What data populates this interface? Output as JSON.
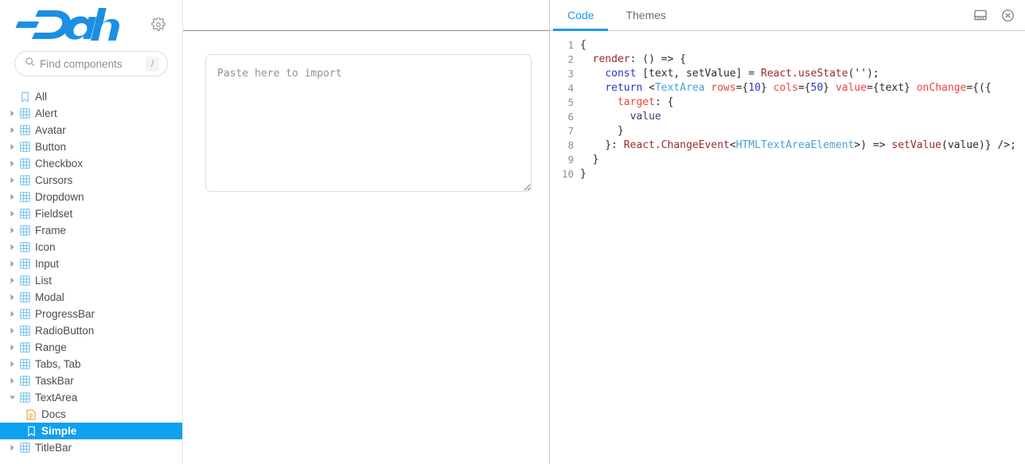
{
  "app": {
    "brand": "Dash",
    "gear_icon": "gear-icon"
  },
  "search": {
    "placeholder": "Find components",
    "value": "",
    "shortcut": "/",
    "icon": "search-icon"
  },
  "sidebar": {
    "items": [
      {
        "label": "All",
        "depth": 0,
        "icon": "bookmark-icon",
        "arrow": "none",
        "selected": false
      },
      {
        "label": "Alert",
        "depth": 0,
        "icon": "grid-icon",
        "arrow": "collapsed",
        "selected": false
      },
      {
        "label": "Avatar",
        "depth": 0,
        "icon": "grid-icon",
        "arrow": "collapsed",
        "selected": false
      },
      {
        "label": "Button",
        "depth": 0,
        "icon": "grid-icon",
        "arrow": "collapsed",
        "selected": false
      },
      {
        "label": "Checkbox",
        "depth": 0,
        "icon": "grid-icon",
        "arrow": "collapsed",
        "selected": false
      },
      {
        "label": "Cursors",
        "depth": 0,
        "icon": "grid-icon",
        "arrow": "collapsed",
        "selected": false
      },
      {
        "label": "Dropdown",
        "depth": 0,
        "icon": "grid-icon",
        "arrow": "collapsed",
        "selected": false
      },
      {
        "label": "Fieldset",
        "depth": 0,
        "icon": "grid-icon",
        "arrow": "collapsed",
        "selected": false
      },
      {
        "label": "Frame",
        "depth": 0,
        "icon": "grid-icon",
        "arrow": "collapsed",
        "selected": false
      },
      {
        "label": "Icon",
        "depth": 0,
        "icon": "grid-icon",
        "arrow": "collapsed",
        "selected": false
      },
      {
        "label": "Input",
        "depth": 0,
        "icon": "grid-icon",
        "arrow": "collapsed",
        "selected": false
      },
      {
        "label": "List",
        "depth": 0,
        "icon": "grid-icon",
        "arrow": "collapsed",
        "selected": false
      },
      {
        "label": "Modal",
        "depth": 0,
        "icon": "grid-icon",
        "arrow": "collapsed",
        "selected": false
      },
      {
        "label": "ProgressBar",
        "depth": 0,
        "icon": "grid-icon",
        "arrow": "collapsed",
        "selected": false
      },
      {
        "label": "RadioButton",
        "depth": 0,
        "icon": "grid-icon",
        "arrow": "collapsed",
        "selected": false
      },
      {
        "label": "Range",
        "depth": 0,
        "icon": "grid-icon",
        "arrow": "collapsed",
        "selected": false
      },
      {
        "label": "Tabs, Tab",
        "depth": 0,
        "icon": "grid-icon",
        "arrow": "collapsed",
        "selected": false
      },
      {
        "label": "TaskBar",
        "depth": 0,
        "icon": "grid-icon",
        "arrow": "collapsed",
        "selected": false
      },
      {
        "label": "TextArea",
        "depth": 0,
        "icon": "grid-icon",
        "arrow": "expanded",
        "selected": false
      },
      {
        "label": "Docs",
        "depth": 1,
        "icon": "doc-icon",
        "arrow": "none",
        "selected": false
      },
      {
        "label": "Simple",
        "depth": 1,
        "icon": "bookmark-icon",
        "arrow": "none",
        "selected": true
      },
      {
        "label": "TitleBar",
        "depth": 0,
        "icon": "grid-icon",
        "arrow": "collapsed",
        "selected": false
      }
    ]
  },
  "preview": {
    "textarea_placeholder": "Paste here to import",
    "textarea_value": ""
  },
  "code_panel": {
    "tabs": [
      {
        "label": "Code",
        "active": true
      },
      {
        "label": "Themes",
        "active": false
      }
    ],
    "window_icons": [
      {
        "name": "panel-layout-icon"
      },
      {
        "name": "close-circle-icon"
      }
    ],
    "line_numbers": [
      "1",
      "2",
      "3",
      "4",
      "5",
      "6",
      "7",
      "8",
      "9",
      "10"
    ],
    "lines": [
      [
        {
          "t": "{",
          "c": "plain"
        }
      ],
      [
        {
          "t": "  ",
          "c": "plain"
        },
        {
          "t": "render",
          "c": "id"
        },
        {
          "t": ": () => {",
          "c": "plain"
        }
      ],
      [
        {
          "t": "    ",
          "c": "plain"
        },
        {
          "t": "const",
          "c": "kw"
        },
        {
          "t": " [text, setValue] = ",
          "c": "plain"
        },
        {
          "t": "React.useState",
          "c": "id"
        },
        {
          "t": "(",
          "c": "plain"
        },
        {
          "t": "''",
          "c": "str"
        },
        {
          "t": ");",
          "c": "plain"
        }
      ],
      [
        {
          "t": "    ",
          "c": "plain"
        },
        {
          "t": "return",
          "c": "kw"
        },
        {
          "t": " <",
          "c": "plain"
        },
        {
          "t": "TextArea",
          "c": "tag"
        },
        {
          "t": " ",
          "c": "plain"
        },
        {
          "t": "rows",
          "c": "attr"
        },
        {
          "t": "={",
          "c": "plain"
        },
        {
          "t": "10",
          "c": "num"
        },
        {
          "t": "} ",
          "c": "plain"
        },
        {
          "t": "cols",
          "c": "attr"
        },
        {
          "t": "={",
          "c": "plain"
        },
        {
          "t": "50",
          "c": "num"
        },
        {
          "t": "} ",
          "c": "plain"
        },
        {
          "t": "value",
          "c": "attr"
        },
        {
          "t": "={text} ",
          "c": "plain"
        },
        {
          "t": "onChange",
          "c": "attr"
        },
        {
          "t": "={({",
          "c": "plain"
        }
      ],
      [
        {
          "t": "      ",
          "c": "plain"
        },
        {
          "t": "target",
          "c": "prop"
        },
        {
          "t": ": {",
          "c": "plain"
        }
      ],
      [
        {
          "t": "        ",
          "c": "plain"
        },
        {
          "t": "value",
          "c": "var"
        }
      ],
      [
        {
          "t": "      }",
          "c": "plain"
        }
      ],
      [
        {
          "t": "    }: ",
          "c": "plain"
        },
        {
          "t": "React.ChangeEvent",
          "c": "id"
        },
        {
          "t": "<",
          "c": "plain"
        },
        {
          "t": "HTMLTextAreaElement",
          "c": "type"
        },
        {
          "t": ">) => ",
          "c": "plain"
        },
        {
          "t": "setValue",
          "c": "id"
        },
        {
          "t": "(value)} />;",
          "c": "plain"
        }
      ],
      [
        {
          "t": "  }",
          "c": "plain"
        }
      ],
      [
        {
          "t": "}",
          "c": "plain"
        }
      ]
    ]
  },
  "colors": {
    "brand_blue": "#1a8fe3",
    "selection_blue": "#10a0f0",
    "tab_active": "#1a9bf0",
    "icon_blue": "#6fbff2",
    "doc_orange": "#f0a030",
    "text": "#4c4c4c"
  }
}
